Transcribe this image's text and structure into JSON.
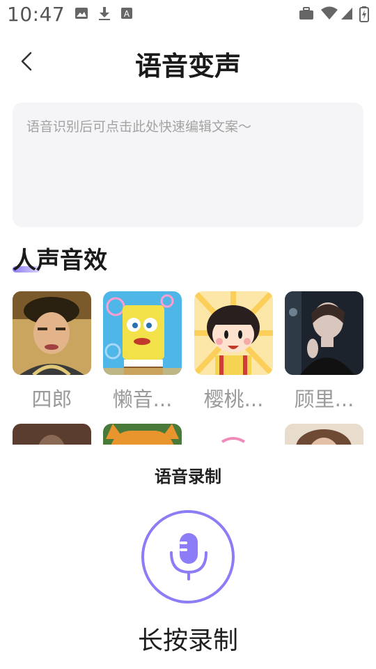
{
  "status_bar": {
    "time": "10:47",
    "icons": [
      "image-icon",
      "download-icon",
      "text-icon",
      "briefcase-icon",
      "wifi-icon",
      "signal-icon",
      "battery-icon"
    ]
  },
  "header": {
    "title": "语音变声"
  },
  "editor": {
    "placeholder": "语音识别后可点击此处快速编辑文案～"
  },
  "effects": {
    "title": "人声音效",
    "accent": "#8c7cf5",
    "items": [
      {
        "label": "四郎",
        "icon": "portrait-man-icon"
      },
      {
        "label": "懒音...",
        "icon": "sponge-cartoon-icon"
      },
      {
        "label": "樱桃...",
        "icon": "girl-cartoon-icon"
      },
      {
        "label": "顾里...",
        "icon": "portrait-woman-icon"
      }
    ]
  },
  "recording": {
    "label": "语音录制",
    "hold_label": "长按录制",
    "accent": "#8c7cf5"
  }
}
